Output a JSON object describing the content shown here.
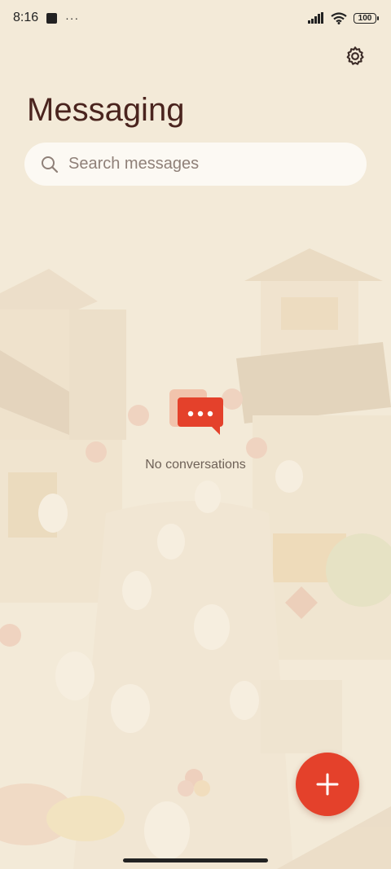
{
  "status": {
    "time": "8:16",
    "more": "···",
    "battery": "100"
  },
  "header": {
    "title": "Messaging"
  },
  "search": {
    "placeholder": "Search messages"
  },
  "empty_state": {
    "text": "No conversations"
  },
  "icons": {
    "settings": "gear-icon",
    "search": "search-icon",
    "empty": "chat-bubble-icon",
    "new_message": "plus-icon"
  },
  "colors": {
    "background": "#f3ead8",
    "accent": "#e4412b",
    "title": "#4a241e"
  }
}
